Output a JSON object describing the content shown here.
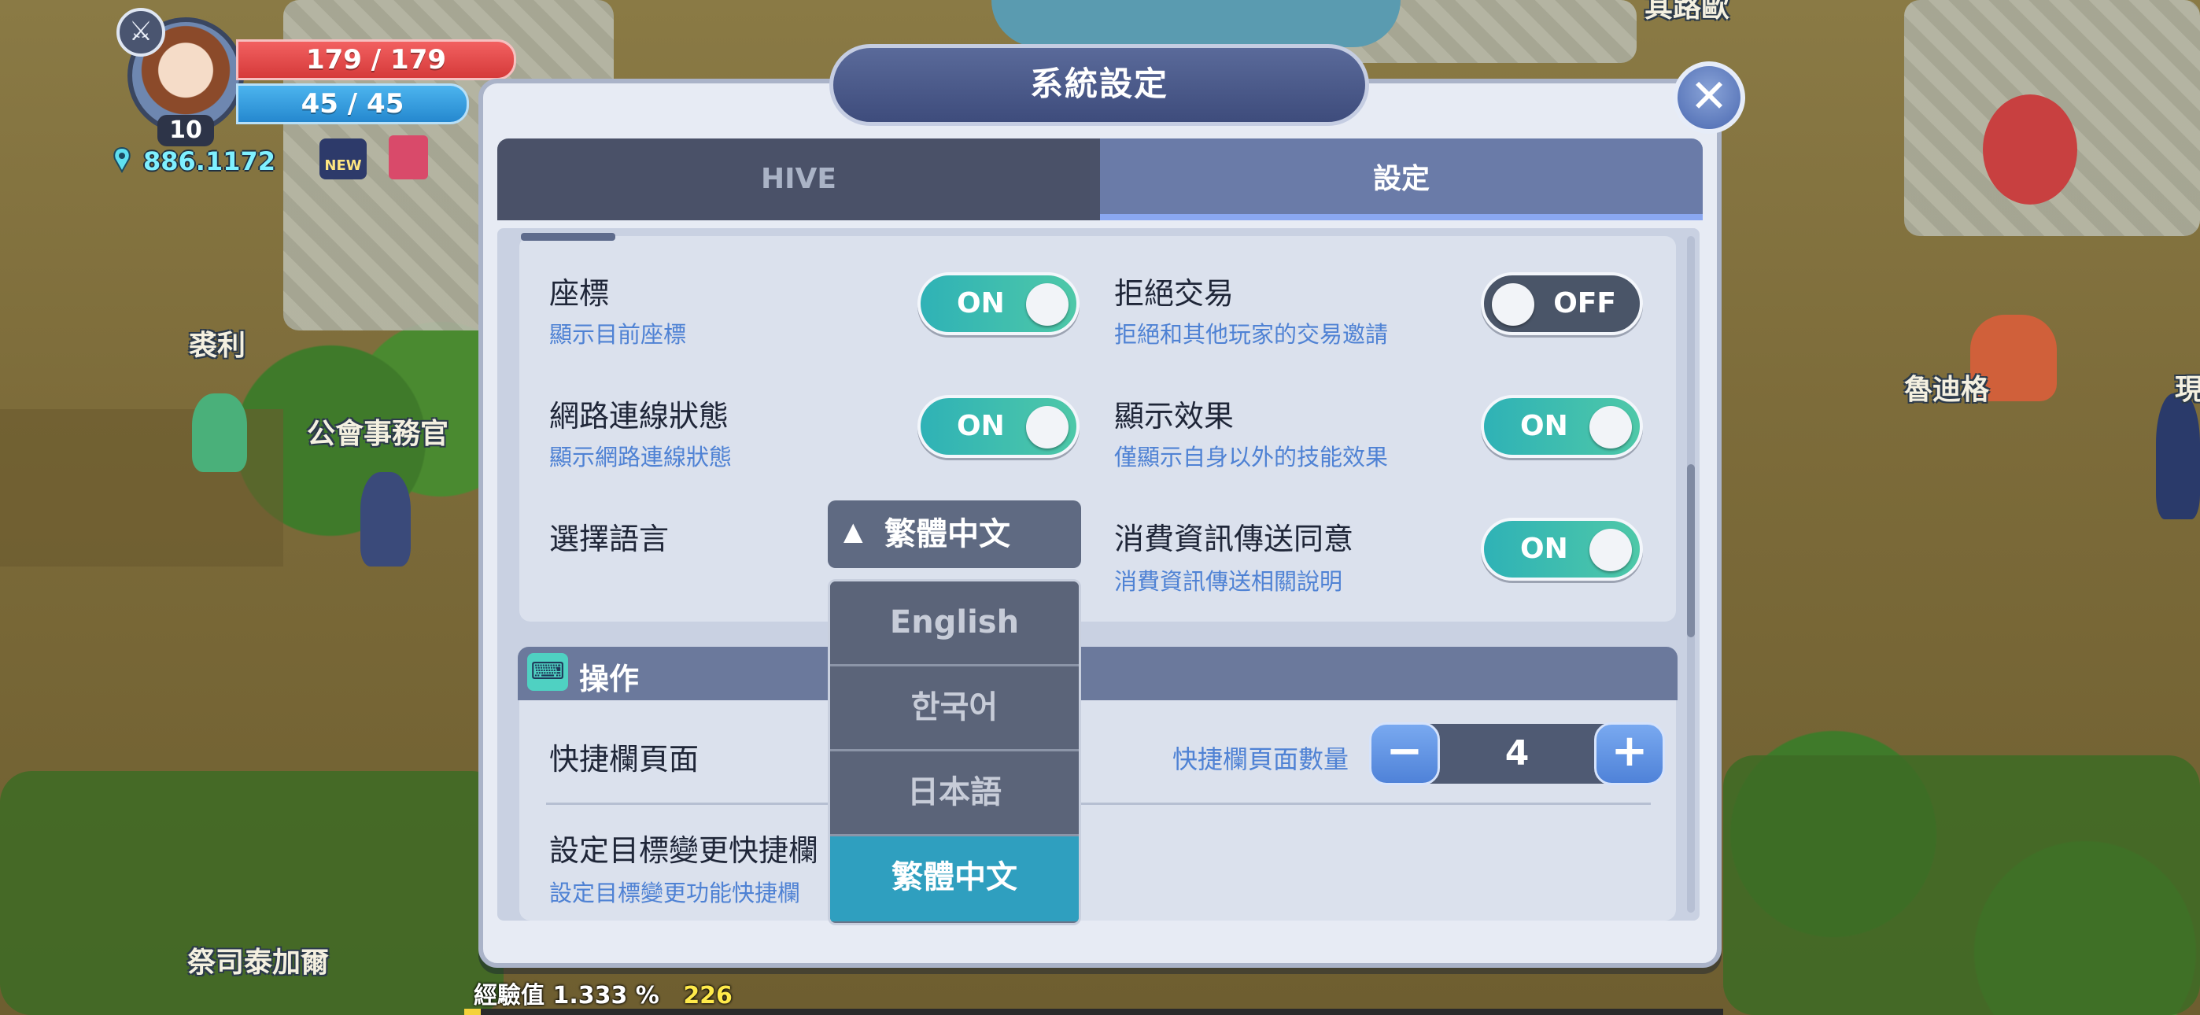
{
  "hud": {
    "level": "10",
    "hp": "179 / 179",
    "mp": "45 / 45",
    "currency": "886.1172",
    "new_badge": "NEW"
  },
  "world_labels": {
    "npc_1": "裘利",
    "npc_2": "公會事務官",
    "npc_3": "魯迪格",
    "npc_4": "祭司泰加爾",
    "npc_5": "現",
    "npc_6": "其路歐"
  },
  "dialog": {
    "title": "系統設定",
    "close_label": "✕",
    "tabs": [
      {
        "label": "HIVE",
        "active": false
      },
      {
        "label": "設定",
        "active": true
      }
    ]
  },
  "settings": {
    "coords": {
      "label": "座標",
      "desc": "顯示目前座標",
      "state": "ON"
    },
    "network": {
      "label": "網路連線狀態",
      "desc": "顯示網路連線狀態",
      "state": "ON"
    },
    "language": {
      "label": "選擇語言",
      "value": "繁體中文",
      "arrow": "▲"
    },
    "reject_trade": {
      "label": "拒絕交易",
      "desc": "拒絕和其他玩家的交易邀請",
      "state": "OFF"
    },
    "show_effects": {
      "label": "顯示效果",
      "desc": "僅顯示自身以外的技能效果",
      "state": "ON"
    },
    "consumption": {
      "label": "消費資訊傳送同意",
      "desc": "消費資訊傳送相關說明",
      "state": "ON"
    }
  },
  "language_options": [
    "English",
    "한국어",
    "日本語",
    "繁體中文"
  ],
  "language_selected_index": 3,
  "operations": {
    "section_title": "操作",
    "section_icon": "keyboard-icon",
    "quickbar_label": "快捷欄頁面",
    "quickbar_count_label": "快捷欄頁面數量",
    "quickbar_count": "4",
    "minus": "−",
    "plus": "+",
    "target_label": "設定目標變更快捷欄",
    "target_desc": "設定目標變更功能快捷欄"
  },
  "exp": {
    "label": "經驗值",
    "percent": "1.333 %",
    "value": "226"
  },
  "colors": {
    "toggle_on": "#2fb2b6",
    "toggle_off": "#4a5568",
    "selected_option": "#2f9fbf",
    "desc_text": "#4f82d4"
  }
}
